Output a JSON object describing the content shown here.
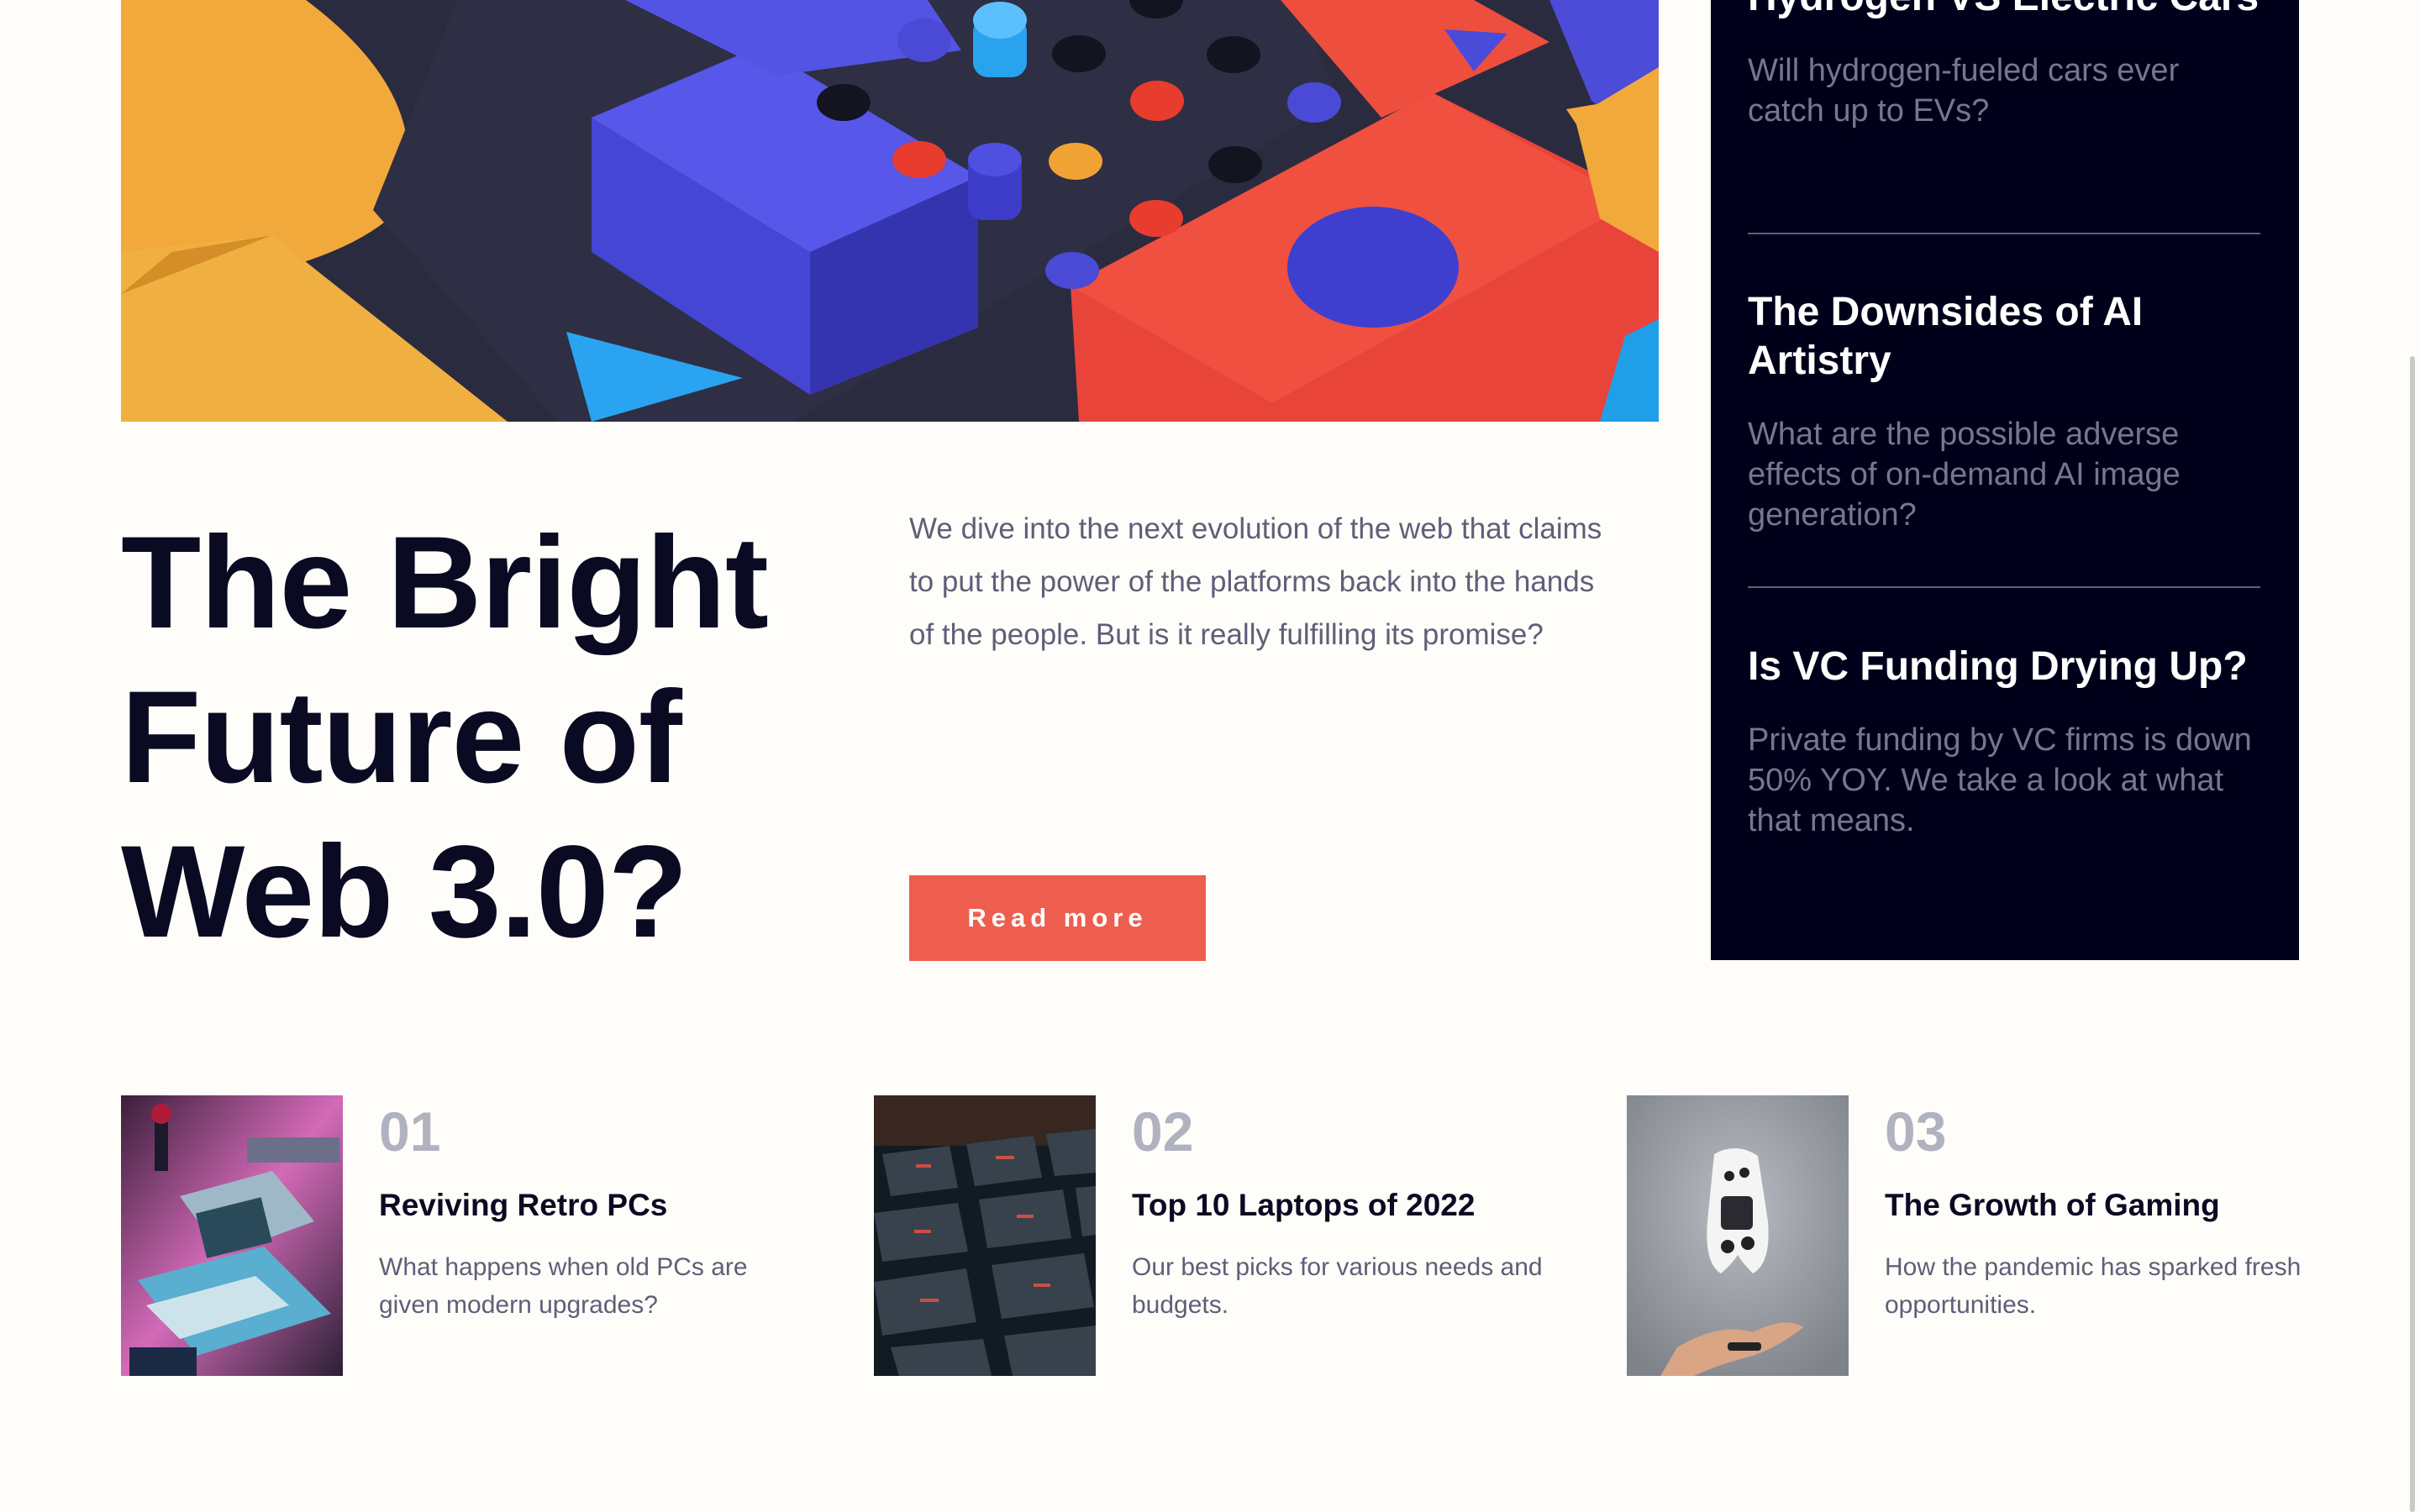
{
  "hero": {
    "headline": "The Bright Future of Web 3.0?",
    "lede": "We dive into the next evolution of the web that claims to put the power of the platforms back into the hands of the people. But is it really fulfilling its promise?",
    "read_more_label": "Read more",
    "accent_color": "#ee5e4e"
  },
  "sidebar": {
    "items": [
      {
        "title": "Hydrogen VS Electric Cars",
        "desc": "Will hydrogen-fueled cars ever catch up to EVs?"
      },
      {
        "title": "The Downsides of AI Artistry",
        "desc": "What are the possible adverse effects of on-demand AI image generation?"
      },
      {
        "title": "Is VC Funding Drying Up?",
        "desc": "Private funding by VC firms is down 50% YOY. We take a look at what that means."
      }
    ],
    "background": "#00001a"
  },
  "cards": [
    {
      "number": "01",
      "title": "Reviving Retro PCs",
      "desc": "What happens when old PCs are given modern upgrades?",
      "image": "retro-pc-image"
    },
    {
      "number": "02",
      "title": "Top 10 Laptops of 2022",
      "desc": "Our best picks for various needs and budgets.",
      "image": "laptop-keyboard-image"
    },
    {
      "number": "03",
      "title": "The Growth of Gaming",
      "desc": "How the pandemic has sparked fresh opportunities.",
      "image": "game-controller-image"
    }
  ]
}
